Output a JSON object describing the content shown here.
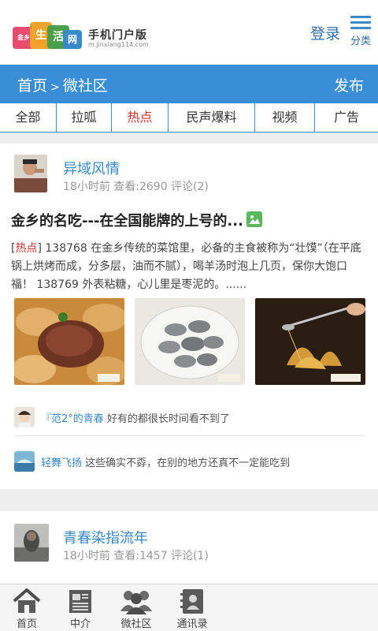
{
  "header": {
    "brand": "手机门户版",
    "brand_url": "m.jinxiang114.com",
    "logo_chars": [
      "金乡",
      "生",
      "活",
      "网"
    ],
    "login": "登录",
    "menu_label": "分类"
  },
  "navbar": {
    "home": "首页",
    "separator": ">",
    "section": "微社区",
    "publish": "发布"
  },
  "tabs": [
    {
      "label": "全部"
    },
    {
      "label": "拉呱"
    },
    {
      "label": "热点",
      "active": true
    },
    {
      "label": "民声爆料"
    },
    {
      "label": "视频"
    },
    {
      "label": "广告"
    }
  ],
  "posts": [
    {
      "author": "异域风情",
      "meta": "18小时前 查看:2690 评论(2)",
      "title": "金乡的名吃---在全国能牌的上号的...",
      "tag": "热点",
      "body": "138768 在金乡传统的菜馆里，必备的主食被称为“壮馍”（在平底锅上烘烤而成，分多层，油而不腻），喝羊汤时泡上几页，保你大饱口福！ 138769 外表粘糖，心儿里是枣泥的。......",
      "comments": [
        {
          "name": "『范2°的青春",
          "text": "好有的都很长时间看不到了"
        },
        {
          "name": "轻舞飞扬",
          "text": "这些确实不孬，在别的地方还真不一定能吃到"
        }
      ]
    },
    {
      "author": "青春染指流年",
      "meta": "18小时前 查看:1457 评论(1)"
    }
  ],
  "bottom_nav": [
    {
      "label": "首页",
      "icon": "home-icon"
    },
    {
      "label": "中介",
      "icon": "newspaper-icon"
    },
    {
      "label": "微社区",
      "icon": "community-icon"
    },
    {
      "label": "通讯录",
      "icon": "contacts-icon"
    }
  ],
  "colors": {
    "accent_blue": "#3a8ed8",
    "link_blue": "#3a89c9",
    "active_red": "#d9302b"
  }
}
